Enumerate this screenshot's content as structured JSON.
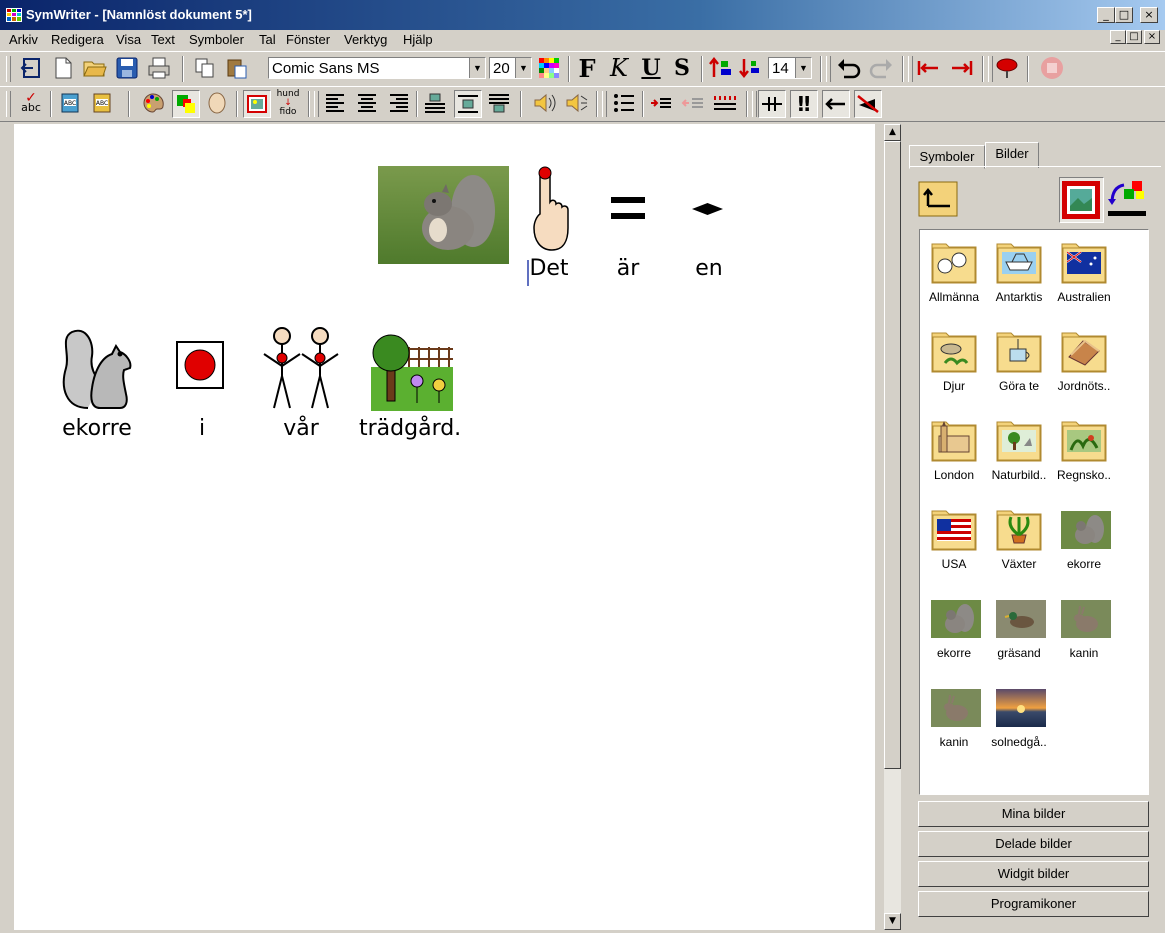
{
  "window": {
    "title": "SymWriter - [Namnlöst dokument 5*]",
    "min_label": "_",
    "max_label": "□",
    "close_label": "×"
  },
  "menu": {
    "items": [
      "Arkiv",
      "Redigera",
      "Visa",
      "Text",
      "Symboler",
      "Tal",
      "Fönster",
      "Verktyg",
      "Hjälp"
    ]
  },
  "toolbar": {
    "font_name": "Comic Sans MS",
    "font_size": "20",
    "bold_label": "F",
    "italic_label": "K",
    "underline_label": "U",
    "strike_label": "S",
    "spacing_value": "14",
    "spell_label": "abc",
    "label_top": "hund",
    "label_bottom": "fido"
  },
  "document": {
    "line1": [
      "Det",
      "är",
      "en"
    ],
    "line2": [
      "ekorre",
      "i",
      "vår",
      "trädgård."
    ]
  },
  "panel": {
    "tabs": [
      "Symboler",
      "Bilder"
    ],
    "active_tab": "Bilder",
    "items": [
      {
        "label": "Allmänna",
        "kind": "folder",
        "icon": "faces-icon"
      },
      {
        "label": "Antarktis",
        "kind": "folder",
        "icon": "ship-icon"
      },
      {
        "label": "Australien",
        "kind": "folder",
        "icon": "australia-flag-icon"
      },
      {
        "label": "Djur",
        "kind": "folder",
        "icon": "animals-icon"
      },
      {
        "label": "Göra te",
        "kind": "folder",
        "icon": "tea-icon"
      },
      {
        "label": "Jordnöts..",
        "kind": "folder",
        "icon": "sandwich-icon"
      },
      {
        "label": "London",
        "kind": "folder",
        "icon": "parliament-icon"
      },
      {
        "label": "Naturbild..",
        "kind": "folder",
        "icon": "nature-icon"
      },
      {
        "label": "Regnsko..",
        "kind": "folder",
        "icon": "rainforest-icon"
      },
      {
        "label": "USA",
        "kind": "folder",
        "icon": "usa-flag-icon"
      },
      {
        "label": "Växter",
        "kind": "folder",
        "icon": "plant-icon"
      },
      {
        "label": "ekorre",
        "kind": "photo",
        "icon": "squirrel-photo"
      },
      {
        "label": "ekorre",
        "kind": "photo",
        "icon": "squirrel-photo"
      },
      {
        "label": "gräsand",
        "kind": "photo",
        "icon": "duck-photo"
      },
      {
        "label": "kanin",
        "kind": "photo",
        "icon": "rabbit-photo"
      },
      {
        "label": "kanin",
        "kind": "photo",
        "icon": "rabbit-photo"
      },
      {
        "label": "solnedgå..",
        "kind": "photo",
        "icon": "sunset-photo"
      }
    ],
    "buttons": [
      "Mina bilder",
      "Delade bilder",
      "Widgit bilder",
      "Programikoner"
    ]
  },
  "colors": {
    "title_start": "#0a246a",
    "title_end": "#a6caf0",
    "face": "#d4d0c8",
    "folder": "#f3d27a",
    "accent_red": "#d40000"
  }
}
